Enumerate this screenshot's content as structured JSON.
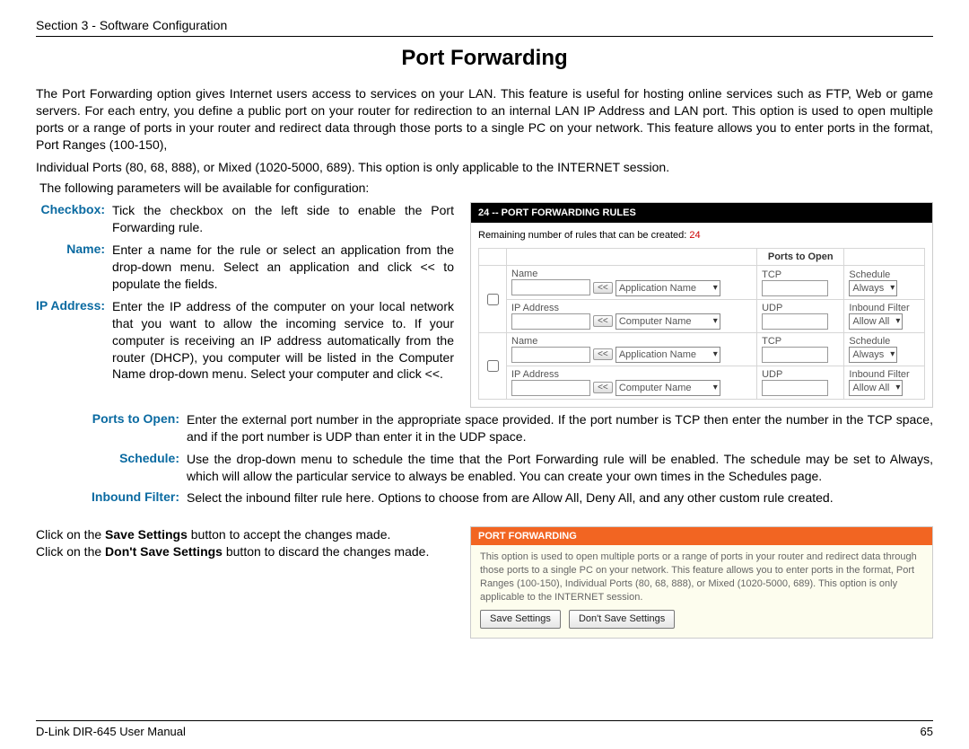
{
  "header": {
    "section": "Section 3 - Software Configuration"
  },
  "title": "Port Forwarding",
  "intro": {
    "p1": "The Port Forwarding option gives Internet users access to services on your LAN. This feature is useful for hosting online services such as FTP, Web or game servers. For each entry, you define a public port on your router for redirection to an internal LAN IP Address and LAN port. This option is used to open multiple ports or a range of ports in your router and redirect data through those ports to a single PC on your network. This feature allows you to enter ports in the format, Port Ranges (100-150),",
    "p2": "Individual Ports (80, 68, 888), or Mixed (1020-5000, 689). This option is only applicable to the INTERNET session."
  },
  "config_intro": "The following parameters will be available for configuration:",
  "defs": {
    "checkbox": {
      "label": "Checkbox:",
      "text": "Tick the checkbox on the left side to enable the Port Forwarding rule."
    },
    "name": {
      "label": "Name:",
      "text": "Enter a name for the rule or select an application from the drop-down menu. Select an application and click << to populate the fields."
    },
    "ipaddress": {
      "label": "IP Address:",
      "text": "Enter the IP address of the computer on your local network that you want to allow the incoming service to. If your computer is receiving an IP address automatically from the router (DHCP), you computer will be listed in the Computer Name drop-down menu. Select your computer and click <<."
    },
    "ports": {
      "label": "Ports to Open:",
      "text": "Enter the external port number in the appropriate space provided. If the port number is TCP then enter the number in the TCP space, and if the port number is UDP than enter it in the UDP space."
    },
    "schedule": {
      "label": "Schedule:",
      "text": "Use the drop-down menu to schedule the time that the Port Forwarding rule will be enabled. The schedule may be set to Always, which will allow the particular service to always be enabled. You can create your own times in the Schedules page."
    },
    "inbound": {
      "label": "Inbound Filter:",
      "text": "Select the inbound filter rule here. Options to choose from are Allow All, Deny All, and any other custom rule created."
    }
  },
  "shot1": {
    "header": "24 -- PORT FORWARDING RULES",
    "remaining_label": "Remaining number of rules that can be created: ",
    "remaining_value": "24",
    "col_ports": "Ports to Open",
    "labels": {
      "name": "Name",
      "ip": "IP Address",
      "tcp": "TCP",
      "udp": "UDP",
      "schedule": "Schedule",
      "inbound": "Inbound Filter",
      "app": "Application Name",
      "comp": "Computer Name",
      "always": "Always",
      "allow": "Allow All",
      "lt": "<<"
    }
  },
  "save_info": {
    "line1a": "Click on the ",
    "line1b": "Save Settings",
    "line1c": " button to accept the changes made.",
    "line2a": "Click on the ",
    "line2b": "Don't Save Settings",
    "line2c": " button to discard the changes made."
  },
  "shot2": {
    "header": "PORT FORWARDING",
    "body": "This option is used to open multiple ports or a range of ports in your router and redirect data through those ports to a single PC on your network. This feature allows you to enter ports in the format, Port Ranges (100-150), Individual Ports (80, 68, 888), or Mixed (1020-5000, 689). This option is only applicable to the INTERNET session.",
    "btn_save": "Save Settings",
    "btn_dont": "Don't Save Settings"
  },
  "footer": {
    "left": "D-Link DIR-645 User Manual",
    "right": "65"
  }
}
